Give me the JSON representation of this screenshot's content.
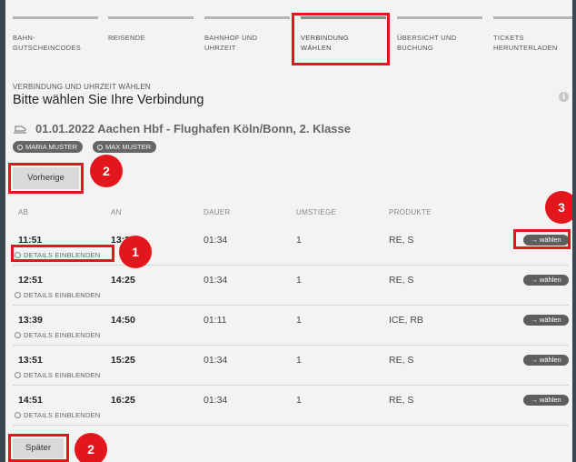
{
  "steps": [
    {
      "label_1": "BAHN-",
      "label_2": "GUTSCHEINCODES",
      "active": false
    },
    {
      "label_1": "REISENDE",
      "label_2": "",
      "active": false
    },
    {
      "label_1": "BAHNHOF UND",
      "label_2": "UHRZEIT",
      "active": false
    },
    {
      "label_1": "VERBINDUNG",
      "label_2": "WÄHLEN",
      "active": true
    },
    {
      "label_1": "ÜBERSICHT UND",
      "label_2": "BUCHUNG",
      "active": false
    },
    {
      "label_1": "TICKETS",
      "label_2": "HERUNTERLADEN",
      "active": false
    }
  ],
  "section": {
    "subheading": "VERBINDUNG UND UHRZEIT WÄHLEN",
    "heading": "Bitte wählen Sie Ihre Verbindung",
    "info_icon": "i"
  },
  "route": {
    "title": "01.01.2022 Aachen Hbf - Flughafen Köln/Bonn, 2. Klasse",
    "icon": "train-icon"
  },
  "passengers": [
    "MARIA MUSTER",
    "MAX MUSTER"
  ],
  "pagination": {
    "previous_label": "Vorherige",
    "next_label": "Später"
  },
  "table": {
    "headers": {
      "departure": "AB",
      "arrival": "AN",
      "duration": "DAUER",
      "changes": "UMSTIEGE",
      "products": "PRODUKTE"
    },
    "details_label": "DETAILS EINBLENDEN",
    "choose_label": "→ wählen",
    "rows": [
      {
        "departure": "11:51",
        "arrival": "13:25",
        "duration": "01:34",
        "changes": "1",
        "products": "RE, S"
      },
      {
        "departure": "12:51",
        "arrival": "14:25",
        "duration": "01:34",
        "changes": "1",
        "products": "RE, S"
      },
      {
        "departure": "13:39",
        "arrival": "14:50",
        "duration": "01:11",
        "changes": "1",
        "products": "ICE, RB"
      },
      {
        "departure": "13:51",
        "arrival": "15:25",
        "duration": "01:34",
        "changes": "1",
        "products": "RE, S"
      },
      {
        "departure": "14:51",
        "arrival": "16:25",
        "duration": "01:34",
        "changes": "1",
        "products": "RE, S"
      }
    ]
  },
  "annotations": {
    "badge_1": "1",
    "badge_2": "2",
    "badge_3": "3"
  },
  "colors": {
    "highlight": "#e3161b",
    "panel": "#f3f3f3",
    "background": "#3c4650",
    "button_dark": "#5e5e5e"
  }
}
